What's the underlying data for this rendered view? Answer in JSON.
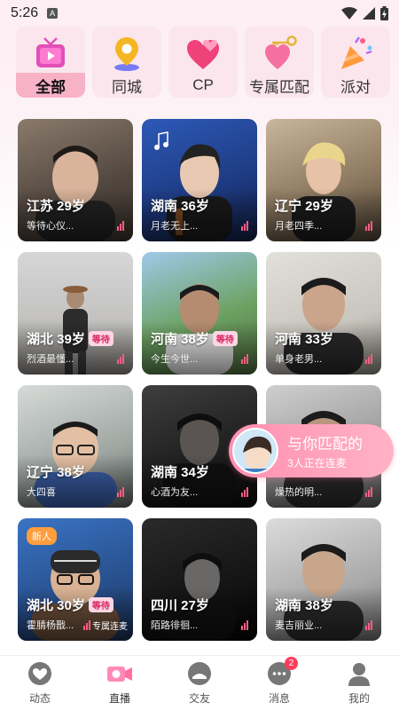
{
  "status_bar": {
    "time": "5:26",
    "notification_badge": "A"
  },
  "categories": [
    {
      "label": "全部",
      "icon": "tv-icon",
      "active": true
    },
    {
      "label": "同城",
      "icon": "location-pin-icon",
      "active": false
    },
    {
      "label": "CP",
      "icon": "hearts-icon",
      "active": false
    },
    {
      "label": "专属匹配",
      "icon": "heart-key-icon",
      "active": false
    },
    {
      "label": "派对",
      "icon": "party-popper-icon",
      "active": false
    }
  ],
  "cards": [
    {
      "title": "江苏 29岁",
      "sub": "等待心仪...",
      "tag": "",
      "new": "",
      "exclusive": ""
    },
    {
      "title": "湖南 36岁",
      "sub": "月老无上...",
      "tag": "",
      "new": "",
      "exclusive": ""
    },
    {
      "title": "辽宁 29岁",
      "sub": "月老四季...",
      "tag": "",
      "new": "",
      "exclusive": ""
    },
    {
      "title": "湖北 39岁",
      "sub": "烈酒最懂...",
      "tag": "等待",
      "new": "",
      "exclusive": ""
    },
    {
      "title": "河南 38岁",
      "sub": "今生今世...",
      "tag": "等待",
      "new": "",
      "exclusive": ""
    },
    {
      "title": "河南 33岁",
      "sub": "单身老男...",
      "tag": "",
      "new": "",
      "exclusive": ""
    },
    {
      "title": "辽宁 38岁",
      "sub": "大四喜",
      "tag": "",
      "new": "",
      "exclusive": ""
    },
    {
      "title": "湖南 34岁",
      "sub": "心酒为友...",
      "tag": "",
      "new": "",
      "exclusive": ""
    },
    {
      "title": "",
      "sub": "燥热的明...",
      "tag": "",
      "new": "",
      "exclusive": ""
    },
    {
      "title": "湖北 30岁",
      "sub": "霍腈杨戬...",
      "tag": "等待",
      "new": "新人",
      "exclusive": "专属连麦"
    },
    {
      "title": "四川 27岁",
      "sub": "陌路徘徊...",
      "tag": "",
      "new": "",
      "exclusive": ""
    },
    {
      "title": "湖南 38岁",
      "sub": "麦吉丽业...",
      "tag": "",
      "new": "",
      "exclusive": ""
    }
  ],
  "match_banner": {
    "title": "与你匹配的",
    "subtitle": "3人正在连麦"
  },
  "tabs": [
    {
      "label": "动态",
      "icon": "heart-bubble-icon",
      "active": false,
      "badge": ""
    },
    {
      "label": "直播",
      "icon": "video-camera-icon",
      "active": true,
      "badge": ""
    },
    {
      "label": "交友",
      "icon": "friends-icon",
      "active": false,
      "badge": ""
    },
    {
      "label": "消息",
      "icon": "chat-bubble-icon",
      "active": false,
      "badge": "2"
    },
    {
      "label": "我的",
      "icon": "profile-icon",
      "active": false,
      "badge": ""
    }
  ],
  "colors": {
    "accent_pink": "#ff5d86",
    "active_category_bg": "#f8b2c8",
    "category_bg": "#fbe6ee",
    "badge_red": "#ff3b5c",
    "new_tag_orange": "#ff9e3d"
  }
}
